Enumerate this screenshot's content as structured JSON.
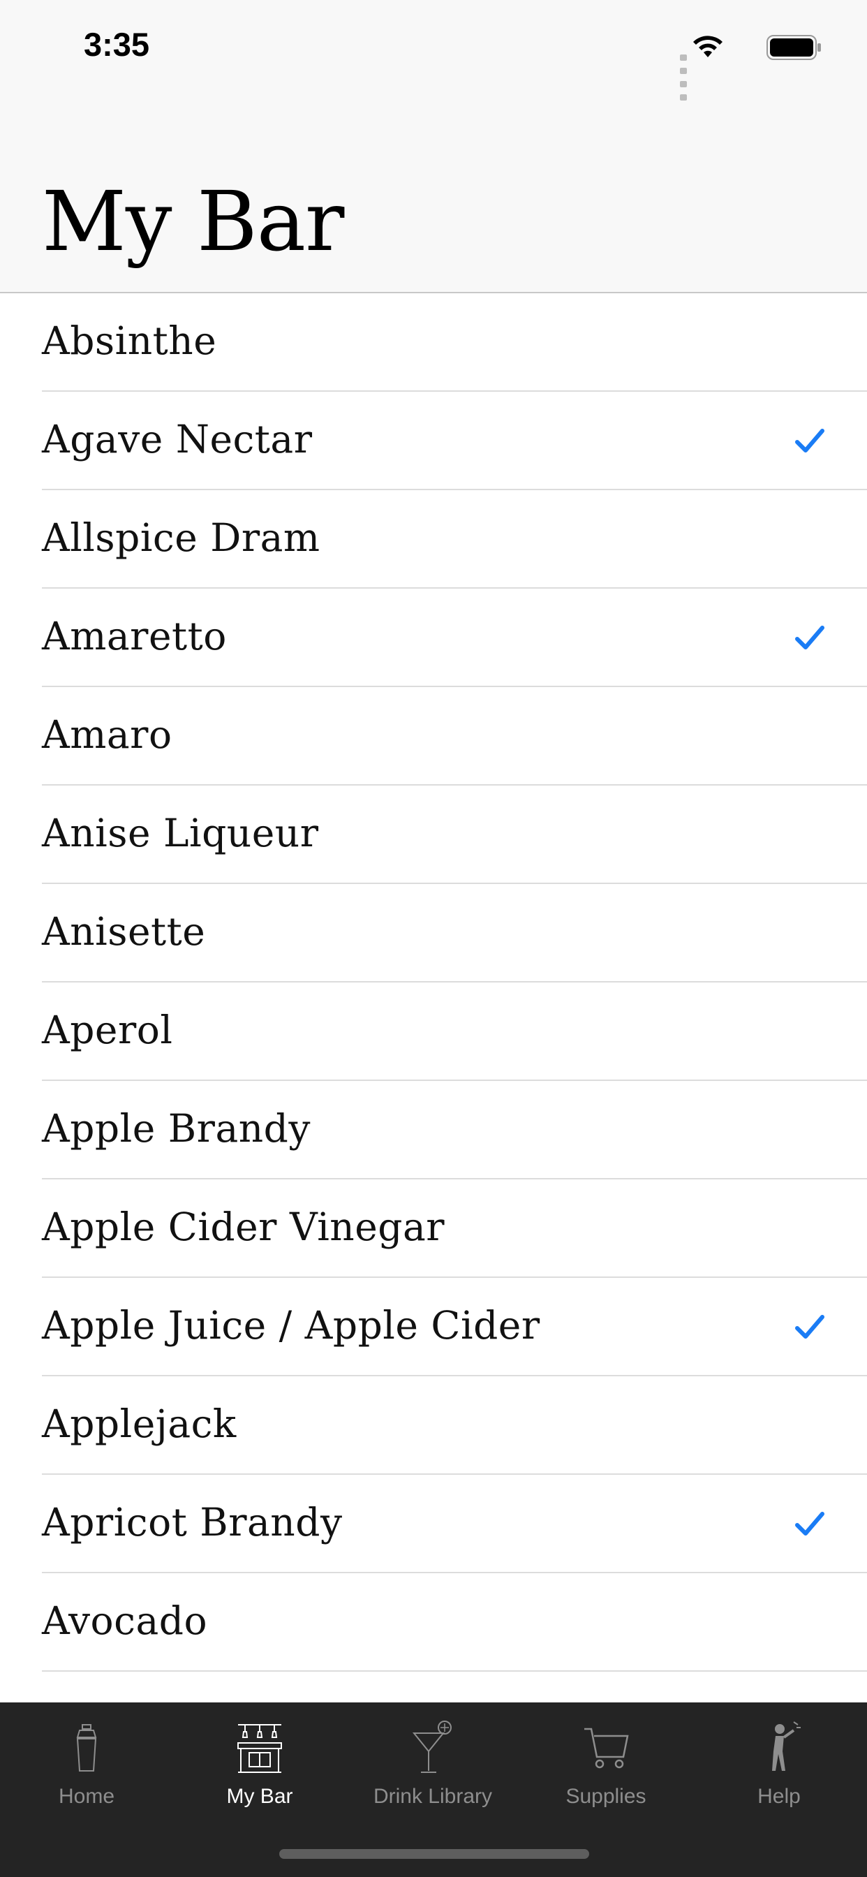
{
  "status_bar": {
    "time": "3:35"
  },
  "header": {
    "title": "My Bar"
  },
  "items": [
    {
      "label": "Absinthe",
      "checked": false
    },
    {
      "label": "Agave Nectar",
      "checked": true
    },
    {
      "label": "Allspice Dram",
      "checked": false
    },
    {
      "label": "Amaretto",
      "checked": true
    },
    {
      "label": "Amaro",
      "checked": false
    },
    {
      "label": "Anise Liqueur",
      "checked": false
    },
    {
      "label": "Anisette",
      "checked": false
    },
    {
      "label": "Aperol",
      "checked": false
    },
    {
      "label": "Apple Brandy",
      "checked": false
    },
    {
      "label": "Apple Cider Vinegar",
      "checked": false
    },
    {
      "label": "Apple Juice / Apple Cider",
      "checked": true
    },
    {
      "label": "Applejack",
      "checked": false
    },
    {
      "label": "Apricot Brandy",
      "checked": true
    },
    {
      "label": "Avocado",
      "checked": false
    }
  ],
  "tabs": [
    {
      "label": "Home",
      "icon": "shaker-icon",
      "active": false
    },
    {
      "label": "My Bar",
      "icon": "bar-icon",
      "active": true
    },
    {
      "label": "Drink Library",
      "icon": "cocktail-glass-icon",
      "active": false
    },
    {
      "label": "Supplies",
      "icon": "cart-icon",
      "active": false
    },
    {
      "label": "Help",
      "icon": "bartender-icon",
      "active": false
    }
  ],
  "colors": {
    "accent": "#1a7cf5",
    "tabbar_bg": "#242424",
    "header_bg": "#f8f8f8"
  }
}
